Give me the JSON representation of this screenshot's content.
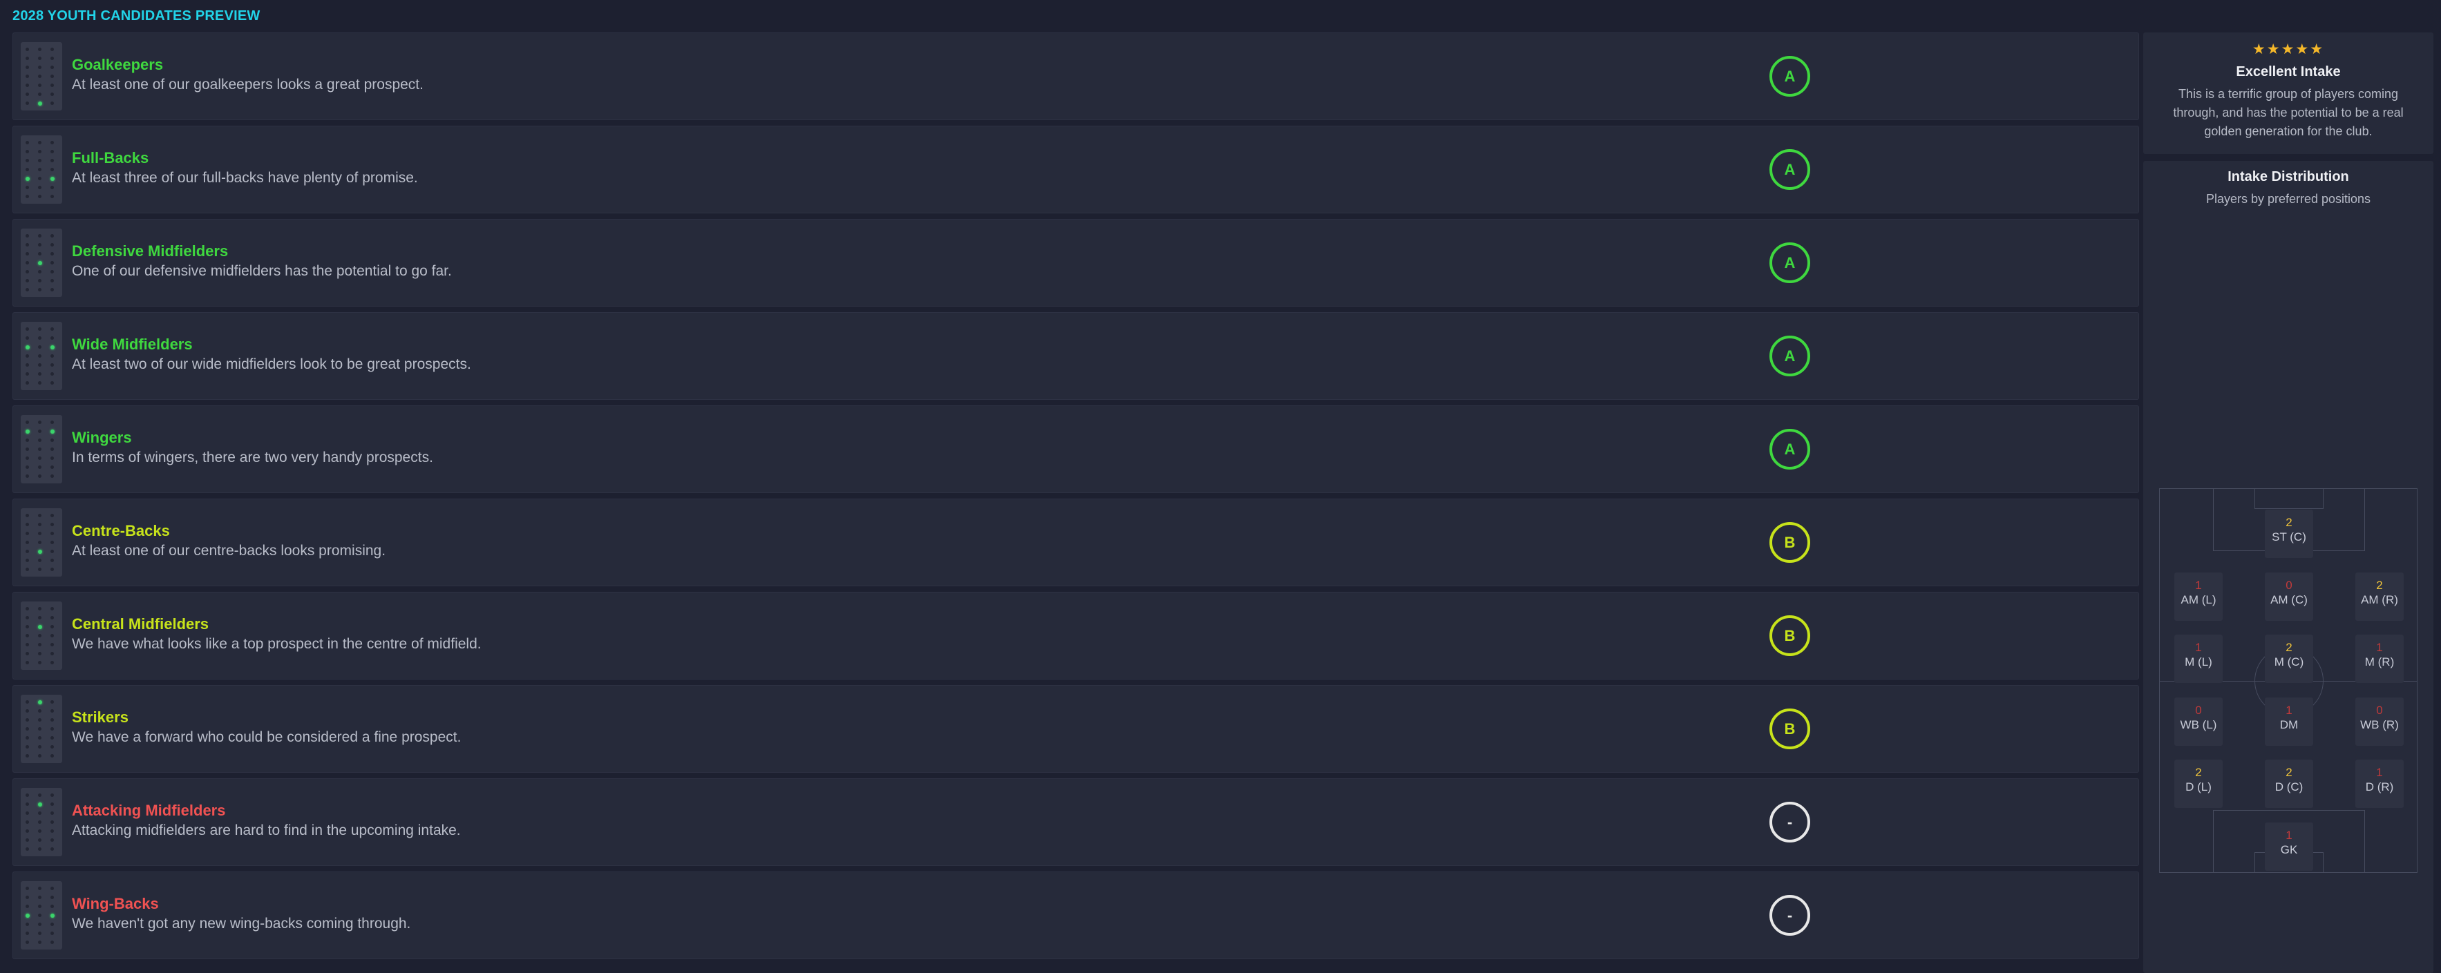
{
  "page": {
    "title": "2028 YOUTH CANDIDATES PREVIEW"
  },
  "rows": [
    {
      "title": "Goalkeepers",
      "description": "At least one of our goalkeepers looks a great prospect.",
      "grade": "A",
      "color": "#3fd83f",
      "icon": "pitch-position-map-icon",
      "highlight": [
        "gk"
      ]
    },
    {
      "title": "Full-Backs",
      "description": "At least three of our full-backs have plenty of promise.",
      "grade": "A",
      "color": "#3fd83f",
      "icon": "pitch-position-map-icon",
      "highlight": [
        "dl",
        "dr"
      ]
    },
    {
      "title": "Defensive Midfielders",
      "description": "One of our defensive midfielders has the potential to go far.",
      "grade": "A",
      "color": "#3fd83f",
      "icon": "pitch-position-map-icon",
      "highlight": [
        "dmc"
      ]
    },
    {
      "title": "Wide Midfielders",
      "description": "At least two of our wide midfielders look to be great prospects.",
      "grade": "A",
      "color": "#3fd83f",
      "icon": "pitch-position-map-icon",
      "highlight": [
        "ml",
        "mr"
      ]
    },
    {
      "title": "Wingers",
      "description": "In terms of wingers, there are two very handy prospects.",
      "grade": "A",
      "color": "#3fd83f",
      "icon": "pitch-position-map-icon",
      "highlight": [
        "aml",
        "amr"
      ]
    },
    {
      "title": "Centre-Backs",
      "description": "At least one of our centre-backs looks promising.",
      "grade": "B",
      "color": "#c7e31b",
      "icon": "pitch-position-map-icon",
      "highlight": [
        "dc"
      ]
    },
    {
      "title": "Central Midfielders",
      "description": "We have what looks like a top prospect in the centre of midfield.",
      "grade": "B",
      "color": "#c7e31b",
      "icon": "pitch-position-map-icon",
      "highlight": [
        "mc"
      ]
    },
    {
      "title": "Strikers",
      "description": "We have a forward who could be considered a fine prospect.",
      "grade": "B",
      "color": "#c7e31b",
      "icon": "pitch-position-map-icon",
      "highlight": [
        "st"
      ]
    },
    {
      "title": "Attacking Midfielders",
      "description": "Attacking midfielders are hard to find in the upcoming intake.",
      "grade": "-",
      "color": "#f05252",
      "icon": "pitch-position-map-icon",
      "highlight": [
        "amc"
      ]
    },
    {
      "title": "Wing-Backs",
      "description": "We haven't got any new wing-backs coming through.",
      "grade": "-",
      "color": "#f05252",
      "icon": "pitch-position-map-icon",
      "highlight": [
        "wbl",
        "wbr"
      ]
    }
  ],
  "summary": {
    "stars": "★★★★★",
    "star_rating": 5,
    "title": "Excellent Intake",
    "description": "This is a terrific group of players coming through, and has the potential to be a real golden generation for the club."
  },
  "distribution": {
    "title": "Intake Distribution",
    "subtitle": "Players by preferred positions",
    "positions": [
      {
        "key": "st",
        "label": "ST (C)",
        "count": "2"
      },
      {
        "key": "aml",
        "label": "AM (L)",
        "count": "1"
      },
      {
        "key": "amc",
        "label": "AM (C)",
        "count": "0"
      },
      {
        "key": "amr",
        "label": "AM (R)",
        "count": "2"
      },
      {
        "key": "ml",
        "label": "M (L)",
        "count": "1"
      },
      {
        "key": "mc",
        "label": "M (C)",
        "count": "2"
      },
      {
        "key": "mr",
        "label": "M (R)",
        "count": "1"
      },
      {
        "key": "wbl",
        "label": "WB (L)",
        "count": "0"
      },
      {
        "key": "dm",
        "label": "DM",
        "count": "1"
      },
      {
        "key": "wbr",
        "label": "WB (R)",
        "count": "0"
      },
      {
        "key": "dl",
        "label": "D (L)",
        "count": "2"
      },
      {
        "key": "dc",
        "label": "D (C)",
        "count": "2"
      },
      {
        "key": "dr",
        "label": "D (R)",
        "count": "1"
      },
      {
        "key": "gk",
        "label": "GK",
        "count": "1"
      }
    ]
  }
}
